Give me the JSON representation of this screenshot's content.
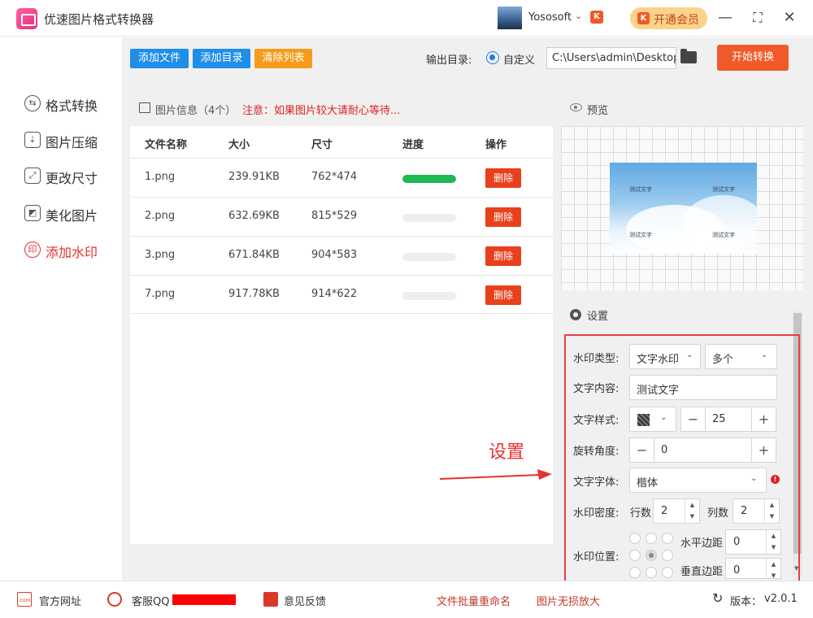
{
  "app": {
    "title": "优速图片格式转换器",
    "user_name": "Yososoft",
    "user_badge": "K",
    "vip_label": "开通会员",
    "vip_icon": "K"
  },
  "window_controls": {
    "minimize": "—",
    "maximize": "⛶",
    "close": "✕"
  },
  "sidebar": {
    "items": [
      {
        "label": "格式转换",
        "icon": "⇆"
      },
      {
        "label": "图片压缩",
        "icon": "⇣"
      },
      {
        "label": "更改尺寸",
        "icon": "⤢"
      },
      {
        "label": "美化图片",
        "icon": "◩"
      },
      {
        "label": "添加水印",
        "icon": "印",
        "active": true
      }
    ]
  },
  "toolbar": {
    "add_file": "添加文件",
    "add_dir": "添加目录",
    "clear_list": "清除列表",
    "output_label": "输出目录:",
    "radio_custom": "自定义",
    "output_path": "C:\\Users\\admin\\Desktop",
    "start": "开始转换"
  },
  "file_panel": {
    "title": "图片信息（4个）",
    "warning": "注意：如果图片较大请耐心等待...",
    "columns": [
      "文件名称",
      "大小",
      "尺寸",
      "进度",
      "操作"
    ],
    "rows": [
      {
        "name": "1.png",
        "size": "239.91KB",
        "dims": "762*474",
        "progress": 1.0,
        "action": "删除"
      },
      {
        "name": "2.png",
        "size": "632.69KB",
        "dims": "815*529",
        "progress": 0,
        "action": "删除"
      },
      {
        "name": "3.png",
        "size": "671.84KB",
        "dims": "904*583",
        "progress": 0,
        "action": "删除"
      },
      {
        "name": "7.png",
        "size": "917.78KB",
        "dims": "914*622",
        "progress": 0,
        "action": "删除"
      }
    ]
  },
  "preview": {
    "title": "预览",
    "watermark_text": "测试文字"
  },
  "settings": {
    "title": "设置",
    "watermark_type_label": "水印类型:",
    "watermark_type": "文字水印",
    "watermark_count": "多个",
    "text_content_label": "文字内容:",
    "text_content": "测试文字",
    "text_style_label": "文字样式:",
    "font_size": "25",
    "minus": "−",
    "plus": "+",
    "rotation_label": "旋转角度:",
    "rotation": "0",
    "font_label": "文字字体:",
    "font": "楷体",
    "font_warning": "!",
    "density_label": "水印密度:",
    "rows_label": "行数",
    "rows": "2",
    "cols_label": "列数",
    "cols": "2",
    "position_label": "水印位置:",
    "h_margin_label": "水平边距",
    "h_margin": "0",
    "v_margin_label": "垂直边距",
    "v_margin": "0"
  },
  "annotation": {
    "text": "设置"
  },
  "footer": {
    "website": "官方网址",
    "qq": "客服QQ",
    "feedback": "意见反馈",
    "batch_rename": "文件批量重命名",
    "lossless": "图片无损放大",
    "version_label": "版本：",
    "version": "v2.0.1"
  },
  "colors": {
    "accent": "#f05a28",
    "blue": "#1f8ee8",
    "orange": "#f59c1a",
    "green": "#1db954",
    "red": "#e63030"
  }
}
